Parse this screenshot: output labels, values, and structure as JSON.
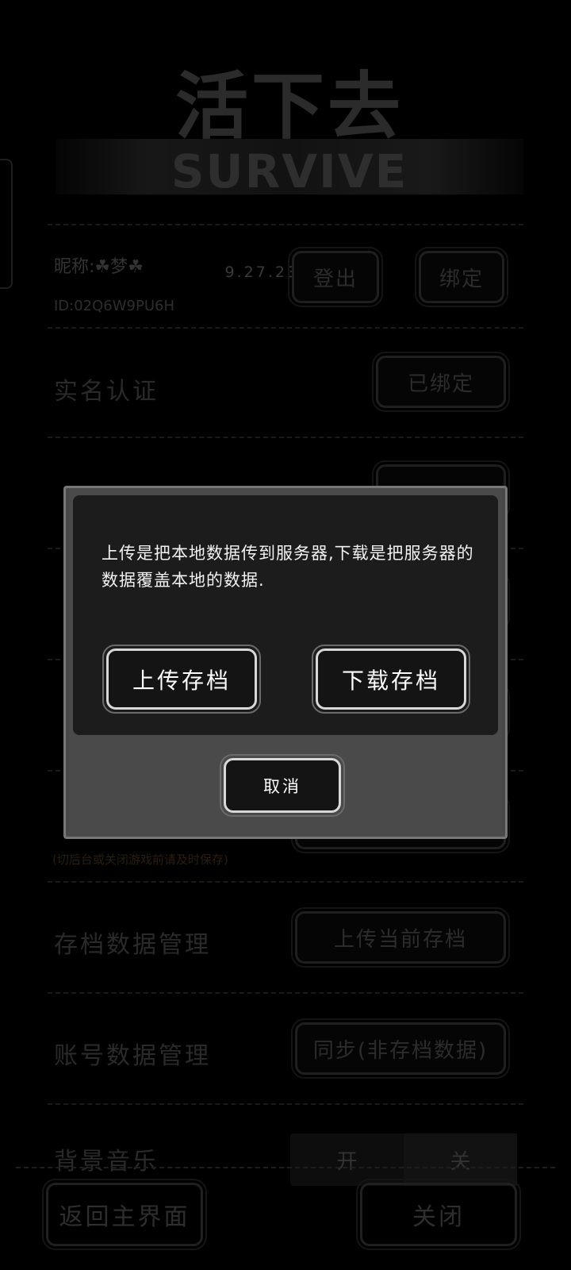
{
  "logo": {
    "title_cn": "活下去",
    "title_en": "SURVIVE",
    "version": "9.27.23277.2"
  },
  "account": {
    "nickname": "昵称:☘梦☘",
    "id": "ID:02Q6W9PU6H",
    "logout_label": "登出",
    "bind_label": "绑定"
  },
  "realname": {
    "label": "实名认证",
    "button": "已绑定"
  },
  "autosave": {
    "hint": "(切后台或关闭游戏前请及时保存)"
  },
  "save_manage": {
    "label": "存档数据管理",
    "button": "上传当前存档"
  },
  "account_manage": {
    "label": "账号数据管理",
    "button": "同步(非存档数据)"
  },
  "music": {
    "label": "背景音乐",
    "on": "开",
    "off": "关"
  },
  "footer": {
    "back_label": "返回主界面",
    "close_label": "关闭"
  },
  "dialog": {
    "message": "上传是把本地数据传到服务器,下载是把服务器的数据覆盖本地的数据.",
    "upload_label": "上传存档",
    "download_label": "下载存档",
    "cancel_label": "取消"
  }
}
